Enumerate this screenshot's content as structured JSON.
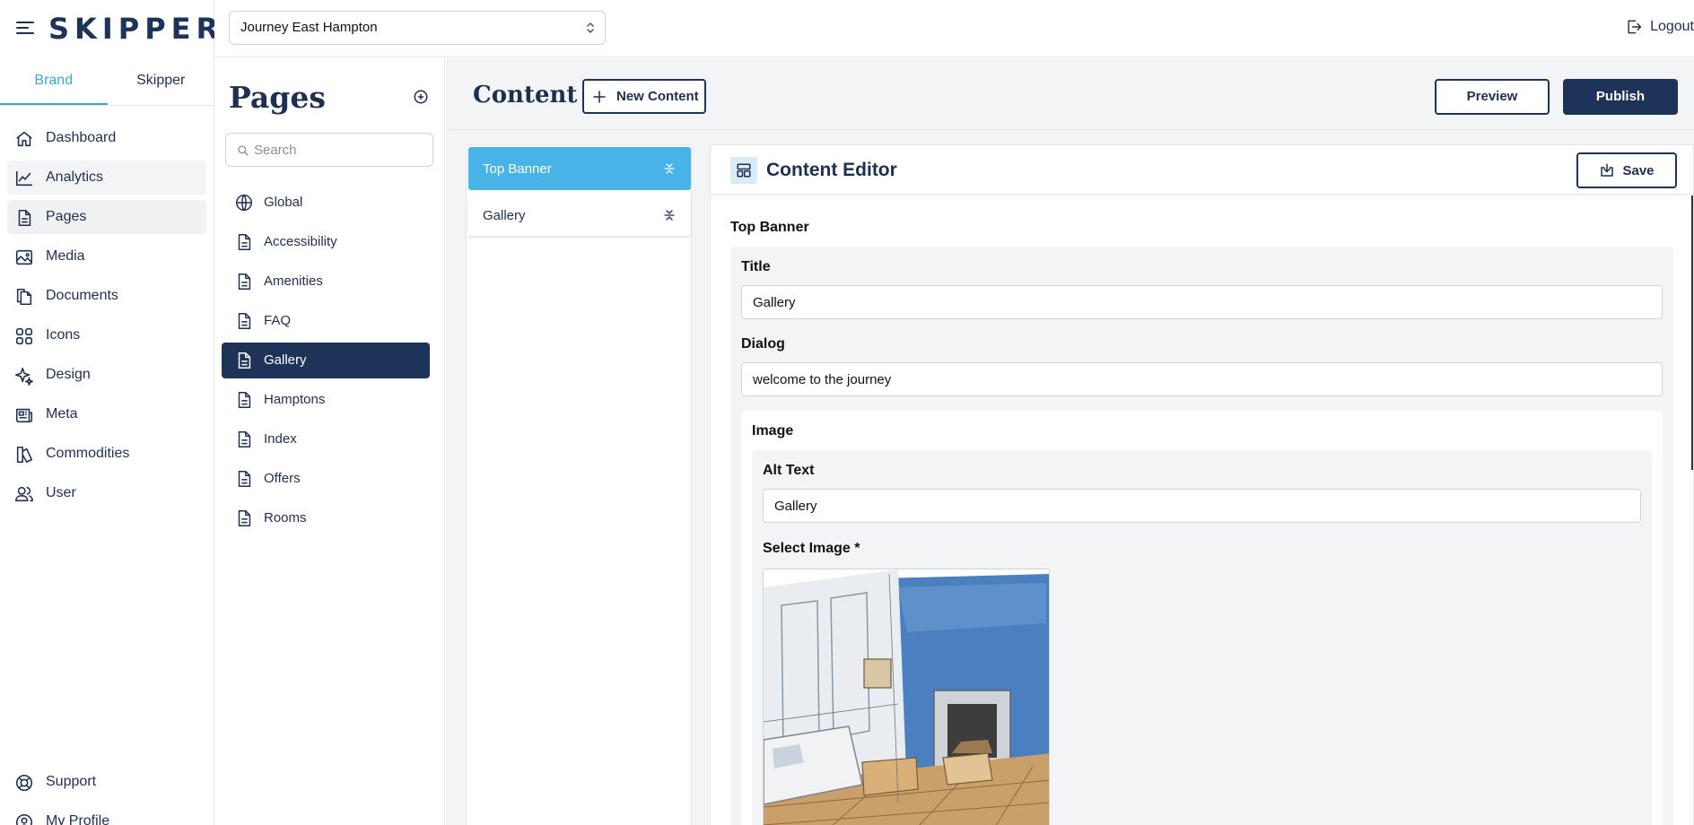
{
  "app": {
    "logo": "SKIPPER",
    "accent": "#3aa7d8",
    "primary": "#1e3358"
  },
  "nav": {
    "tabs": [
      {
        "label": "Brand",
        "active": true
      },
      {
        "label": "Skipper",
        "active": false
      }
    ],
    "items": [
      {
        "label": "Dashboard",
        "icon": "home-icon"
      },
      {
        "label": "Analytics",
        "icon": "analytics-icon"
      },
      {
        "label": "Pages",
        "icon": "document-icon"
      },
      {
        "label": "Media",
        "icon": "image-icon"
      },
      {
        "label": "Documents",
        "icon": "documents-icon"
      },
      {
        "label": "Icons",
        "icon": "grid-icon"
      },
      {
        "label": "Design",
        "icon": "sparkle-icon"
      },
      {
        "label": "Meta",
        "icon": "newspaper-icon"
      },
      {
        "label": "Commodities",
        "icon": "chart-pie-icon"
      },
      {
        "label": "User",
        "icon": "users-icon"
      }
    ],
    "footer": [
      {
        "label": "Support",
        "icon": "lifebuoy-icon"
      },
      {
        "label": "My Profile",
        "icon": "profile-icon"
      }
    ]
  },
  "header": {
    "site": "Journey East Hampton",
    "logout": "Logout"
  },
  "pages": {
    "title": "Pages",
    "search_placeholder": "Search",
    "items": [
      {
        "label": "Global",
        "icon": "globe-icon"
      },
      {
        "label": "Accessibility",
        "icon": "document-icon"
      },
      {
        "label": "Amenities",
        "icon": "document-icon"
      },
      {
        "label": "FAQ",
        "icon": "document-icon"
      },
      {
        "label": "Gallery",
        "icon": "document-icon",
        "active": true
      },
      {
        "label": "Hamptons",
        "icon": "document-icon"
      },
      {
        "label": "Index",
        "icon": "document-icon"
      },
      {
        "label": "Offers",
        "icon": "document-icon"
      },
      {
        "label": "Rooms",
        "icon": "document-icon"
      }
    ]
  },
  "content": {
    "title": "Content",
    "new_content": "New Content",
    "preview": "Preview",
    "publish": "Publish",
    "blocks": [
      {
        "label": "Top Banner",
        "active": true
      },
      {
        "label": "Gallery",
        "active": false
      }
    ]
  },
  "editor": {
    "title": "Content Editor",
    "save": "Save",
    "section": "Top Banner",
    "fields": {
      "title_label": "Title",
      "title_value": "Gallery",
      "dialog_label": "Dialog",
      "dialog_value": "welcome to the journey",
      "image_label": "Image",
      "alt_label": "Alt Text",
      "alt_value": "Gallery",
      "select_label": "Select Image *"
    }
  }
}
